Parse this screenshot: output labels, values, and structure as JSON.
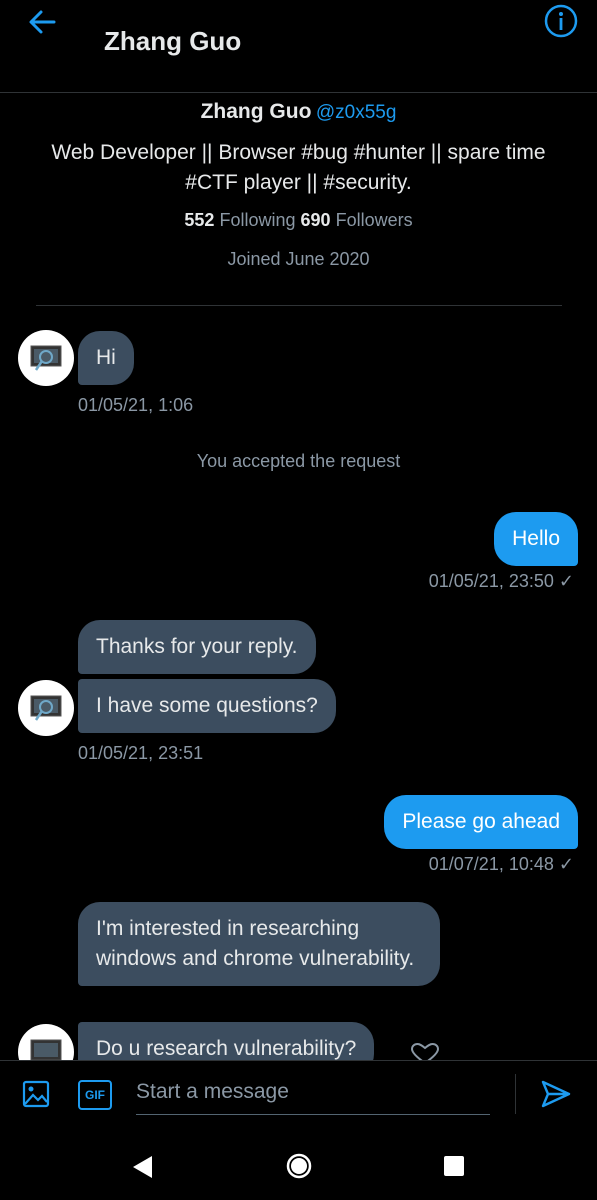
{
  "header": {
    "title": "Zhang Guo",
    "back_icon": "arrow-left-icon",
    "info_icon": "info-icon",
    "accent": "#1d9bf0"
  },
  "profile": {
    "name": "Zhang Guo",
    "handle": "@z0x55g",
    "bio_line1": "Web Developer || Browser #bug #hunter || spare time",
    "bio_line2": "#CTF player || #security.",
    "following_count": "552",
    "following_label": "Following",
    "followers_count": "690",
    "followers_label": "Followers",
    "joined": "Joined June 2020"
  },
  "messages": {
    "m1": {
      "text": "Hi",
      "time": "01/05/21, 1:06"
    },
    "system": "You accepted the request",
    "m2": {
      "text": "Hello",
      "time": "01/05/21, 23:50"
    },
    "m3": {
      "text": "Thanks for your reply."
    },
    "m4": {
      "text": "I have some questions?",
      "time": "01/05/21, 23:51"
    },
    "m5": {
      "text": "Please go ahead",
      "time": "01/07/21, 10:48"
    },
    "m6": {
      "text": "I'm interested in researching windows and chrome vulnerability."
    },
    "m7": {
      "text": "Do u research vulnerability?"
    }
  },
  "composer": {
    "placeholder": "Start a message",
    "gif_label": "GIF",
    "image_icon": "image-icon",
    "send_icon": "send-icon"
  },
  "navbar": {
    "back_icon": "nav-back-icon",
    "home_icon": "nav-home-icon",
    "recents_icon": "nav-recents-icon"
  }
}
